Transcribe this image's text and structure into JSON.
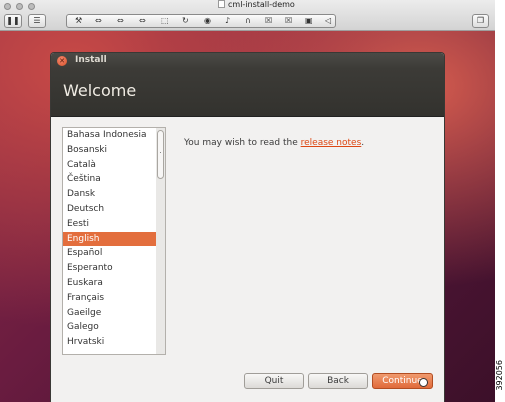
{
  "window": {
    "title": "cml-install-demo"
  },
  "toolbar": {
    "pause_icon": "❚❚",
    "settings_icon": "☰",
    "group_icons": [
      "⚒",
      "⇔",
      "⇔",
      "⇔",
      "⬚",
      "↻",
      "◉",
      "♪",
      "∩",
      "☒",
      "☒",
      "▣",
      "◁"
    ],
    "fullscreen_icon": "❐"
  },
  "installer": {
    "title": "Install",
    "header": "Welcome",
    "languages": [
      "Bahasa Indonesia",
      "Bosanski",
      "Català",
      "Čeština",
      "Dansk",
      "Deutsch",
      "Eesti",
      "English",
      "Español",
      "Esperanto",
      "Euskara",
      "Français",
      "Gaeilge",
      "Galego",
      "Hrvatski"
    ],
    "selected_language": "English",
    "notes_prefix": "You may wish to read the ",
    "notes_link": "release notes",
    "notes_suffix": ".",
    "buttons": {
      "quit": "Quit",
      "back": "Back",
      "continue": "Continue"
    }
  },
  "figure_id": "392056",
  "colors": {
    "accent": "#e36e3d",
    "link": "#dd4814",
    "header": "#3c3b37"
  }
}
